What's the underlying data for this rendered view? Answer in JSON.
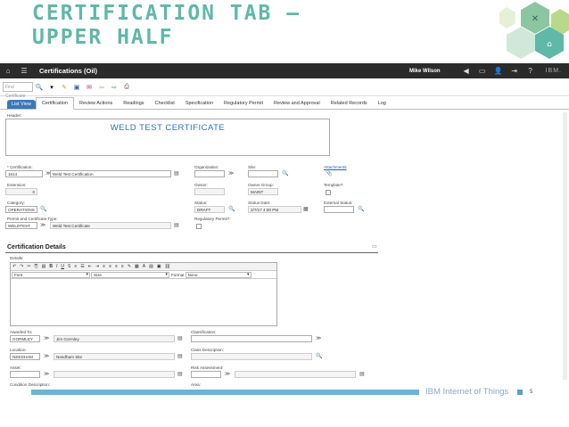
{
  "slide": {
    "title_line1": "Certification tab –",
    "title_line2": "Upper Half",
    "footer_text": "IBM Internet of Things",
    "page_number": "5"
  },
  "topbar": {
    "app_title": "Certifications (Oil)",
    "user": "Mike Wilson",
    "brand": "IBM."
  },
  "toolbar": {
    "find_placeholder": "Find Certificate"
  },
  "tabs": [
    "List View",
    "Certification",
    "Review Actions",
    "Readings",
    "Checklist",
    "Specification",
    "Regulatory Permit",
    "Review and Approval",
    "Related Records",
    "Log"
  ],
  "form": {
    "header_label": "Header:",
    "header_value": "WELD TEST CERTIFICATE",
    "certification_label": "* Certification:",
    "certification_value": "1614",
    "certification_desc": "Weld Test Certification",
    "extension_label": "Extension:",
    "extension_value": "0",
    "category_label": "Category:",
    "category_value": "OPERATIONS",
    "permit_type_label": "Permit and Certificate Type:",
    "permit_type_value": "WELDTEST",
    "permit_type_desc": "Weld Test Certificate",
    "organization_label": "Organization:",
    "owner_label": "Owner:",
    "status_label": "Status:",
    "status_value": "DRAFT",
    "regulatory_permit_label": "Regulatory Permit?:",
    "site_label": "Site:",
    "owner_group_label": "Owner Group:",
    "owner_group_value": "MAINT",
    "status_date_label": "Status Date:",
    "status_date_value": "2/7/17 4:00 PM",
    "attachments_label": "Attachments",
    "template_label": "Template?:",
    "external_status_label": "External Status:"
  },
  "details_section": {
    "title": "Certification Details",
    "details_label": "Details:",
    "font_label": "Font",
    "size_label": "Size",
    "format_label": "Format",
    "format_value": "None",
    "awarded_to_label": "Awarded To:",
    "awarded_to_value": "GORMLEY",
    "awarded_to_desc": "Jim Gormley",
    "location_label": "Location:",
    "location_value": "NEEDHAM",
    "location_desc": "Needham Site",
    "asset_label": "Asset:",
    "classification_label": "Classification:",
    "class_desc_label": "Class Description:",
    "risk_label": "Risk Assessment:",
    "extra_label1": "Condition Description:",
    "extra_label2": "Area:"
  }
}
